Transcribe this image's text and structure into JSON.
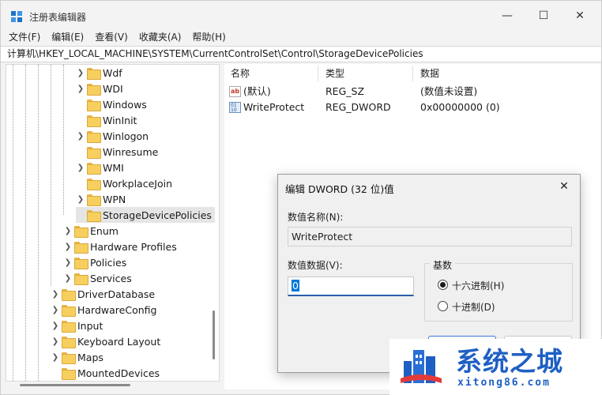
{
  "window": {
    "title": "注册表编辑器",
    "minimize_glyph": "—",
    "maximize_glyph": "☐",
    "close_glyph": "✕"
  },
  "menu": [
    "文件(F)",
    "编辑(E)",
    "查看(V)",
    "收藏夹(A)",
    "帮助(H)"
  ],
  "address": "计算机\\HKEY_LOCAL_MACHINE\\SYSTEM\\CurrentControlSet\\Control\\StorageDevicePolicies",
  "tree": {
    "items": [
      {
        "label": "Wdf",
        "expandable": true
      },
      {
        "label": "WDI",
        "expandable": true
      },
      {
        "label": "Windows",
        "expandable": false
      },
      {
        "label": "WinInit",
        "expandable": false
      },
      {
        "label": "Winlogon",
        "expandable": true
      },
      {
        "label": "Winresume",
        "expandable": false
      },
      {
        "label": "WMI",
        "expandable": true
      },
      {
        "label": "WorkplaceJoin",
        "expandable": false
      },
      {
        "label": "WPN",
        "expandable": true
      },
      {
        "label": "StorageDevicePolicies",
        "expandable": false,
        "selected": true
      },
      {
        "label": "Enum",
        "expandable": true
      },
      {
        "label": "Hardware Profiles",
        "expandable": true
      },
      {
        "label": "Policies",
        "expandable": true
      },
      {
        "label": "Services",
        "expandable": true
      },
      {
        "label": "DriverDatabase",
        "expandable": true
      },
      {
        "label": "HardwareConfig",
        "expandable": true
      },
      {
        "label": "Input",
        "expandable": true
      },
      {
        "label": "Keyboard Layout",
        "expandable": true
      },
      {
        "label": "Maps",
        "expandable": true
      },
      {
        "label": "MountedDevices",
        "expandable": false
      }
    ]
  },
  "list": {
    "headers": {
      "name": "名称",
      "type": "类型",
      "data": "数据"
    },
    "rows": [
      {
        "name": "(默认)",
        "type": "REG_SZ",
        "data": "(数值未设置)",
        "icon": "string-value-icon"
      },
      {
        "name": "WriteProtect",
        "type": "REG_DWORD",
        "data": "0x00000000 (0)",
        "icon": "binary-value-icon"
      }
    ]
  },
  "dialog": {
    "title": "编辑 DWORD (32 位)值",
    "close_glyph": "✕",
    "name_label": "数值名称(N):",
    "name_value": "WriteProtect",
    "data_label": "数值数据(V):",
    "data_value": "0",
    "base_label": "基数",
    "radio_hex": "十六进制(H)",
    "radio_dec": "十进制(D)",
    "selected_base": "hex"
  },
  "watermark": {
    "text": "系统之城",
    "url": "xitong86.com"
  },
  "colors": {
    "accent": "#0078d7",
    "watermark_blue": "#1e5fc4"
  }
}
